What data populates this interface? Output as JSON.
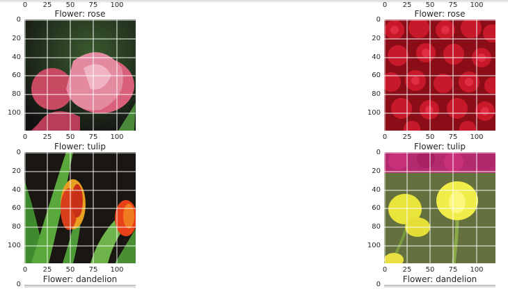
{
  "figure": {
    "titles": [
      "Flower: rose",
      "Flower: rose",
      "Flower: tulip",
      "Flower: tulip",
      "Flower: dandelion",
      "Flower: dandelion"
    ],
    "x_ticks": [
      "0",
      "25",
      "50",
      "75",
      "100"
    ],
    "y_ticks": [
      "0",
      "20",
      "40",
      "60",
      "80",
      "100"
    ]
  },
  "images": {
    "rose_left": "pink rose close-up",
    "rose_right": "field of red roses",
    "tulip_left": "red-orange tulips on dark background",
    "tulip_right": "yellow tulips with magenta flowers behind"
  }
}
